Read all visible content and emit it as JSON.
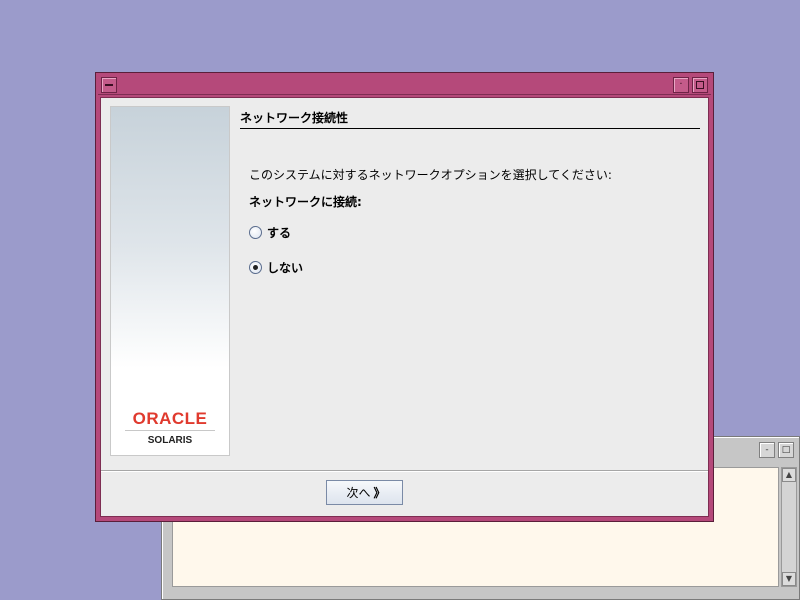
{
  "background_window": {
    "title_buttons": [
      "-",
      "□"
    ],
    "scroll_up": "▲",
    "scroll_down": "▼"
  },
  "dialog": {
    "title_buttons": {
      "minimize": "·",
      "maximize": "□"
    },
    "page_title": "ネットワーク接続性",
    "prompt": "このシステムに対するネットワークオプションを選択してください:",
    "connect_label": "ネットワークに接続:",
    "options": [
      {
        "label": "する",
        "selected": false
      },
      {
        "label": "しない",
        "selected": true
      }
    ],
    "next_button": {
      "label": "次へ",
      "icon": "double-chevron-right-icon",
      "glyph": "》"
    },
    "logo": {
      "brand": "ORACLE",
      "product": "SOLARIS"
    }
  },
  "colors": {
    "desktop": "#9b9bcb",
    "title_bar": "#b5497a",
    "oracle_red": "#e03a2e"
  }
}
